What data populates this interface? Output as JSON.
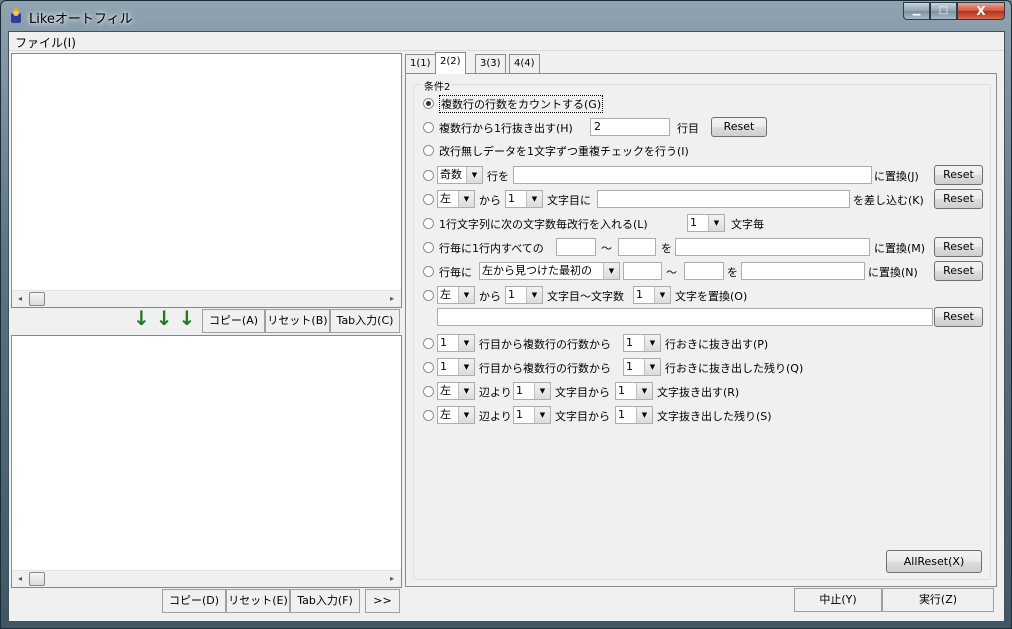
{
  "window": {
    "title": "Likeオートフィル",
    "close_glyph": "X",
    "min_glyph": "▁",
    "max_glyph": "□"
  },
  "menu": {
    "file": "ファイル(I)"
  },
  "upper_pane": {
    "arrows": "↓↓↓",
    "copy": "コピー(A)",
    "reset": "リセット(B)",
    "tab_input": "Tab入力(C)"
  },
  "lower_pane": {
    "copy": "コピー(D)",
    "reset": "リセット(E)",
    "tab_input": "Tab入力(F)",
    "more": ">>"
  },
  "tabs": [
    "1(1)",
    "2(2)",
    "3(3)",
    "4(4)"
  ],
  "group": {
    "label": "条件2"
  },
  "options": {
    "r1": {
      "text": "複数行の行数をカウントする(G)"
    },
    "r2": {
      "text": "複数行から1行抜き出す(H)",
      "value": "2",
      "suffix": "行目",
      "reset": "Reset"
    },
    "r3": {
      "text": "改行無しデータを1文字ずつ重複チェックを行う(I)"
    },
    "r4": {
      "combo": "奇数",
      "mid": "行を",
      "value": "",
      "suffix": "に置換(J)",
      "reset": "Reset"
    },
    "r5": {
      "combo1": "左",
      "mid1": "から",
      "combo2": "1",
      "mid2": "文字目に",
      "value": "",
      "suffix": "を差し込む(K)",
      "reset": "Reset"
    },
    "r6": {
      "text": "1行文字列に次の文字数毎改行を入れる(L)",
      "combo": "1",
      "suffix": "文字毎"
    },
    "r7": {
      "prefix": "行毎に1行内すべての",
      "tilde": "～",
      "mid": "を",
      "suffix": "に置換(M)",
      "reset": "Reset"
    },
    "r8": {
      "prefix": "行毎に",
      "combo": "左から見つけた最初の",
      "tilde": "～",
      "mid": "を",
      "suffix": "に置換(N)",
      "reset": "Reset"
    },
    "r9": {
      "combo1": "左",
      "mid1": "から",
      "combo2": "1",
      "mid2": "文字目～文字数",
      "combo3": "1",
      "suffix": "文字を置換(O)",
      "reset": "Reset"
    },
    "r10": {
      "combo1": "1",
      "mid": "行目から複数行の行数から",
      "combo2": "1",
      "suffix": "行おきに抜き出す(P)"
    },
    "r11": {
      "combo1": "1",
      "mid": "行目から複数行の行数から",
      "combo2": "1",
      "suffix": "行おきに抜き出した残り(Q)"
    },
    "r12": {
      "combo1": "左",
      "mid1": "辺より",
      "combo2": "1",
      "mid2": "文字目から",
      "combo3": "1",
      "suffix": "文字抜き出す(R)"
    },
    "r13": {
      "combo1": "左",
      "mid1": "辺より",
      "combo2": "1",
      "mid2": "文字目から",
      "combo3": "1",
      "suffix": "文字抜き出した残り(S)"
    }
  },
  "all_reset": "AllReset(X)",
  "status": {
    "stop": "中止(Y)",
    "run": "実行(Z)"
  },
  "scroll": {
    "left": "◂",
    "right": "▸"
  },
  "dropdown_glyph": "▼"
}
